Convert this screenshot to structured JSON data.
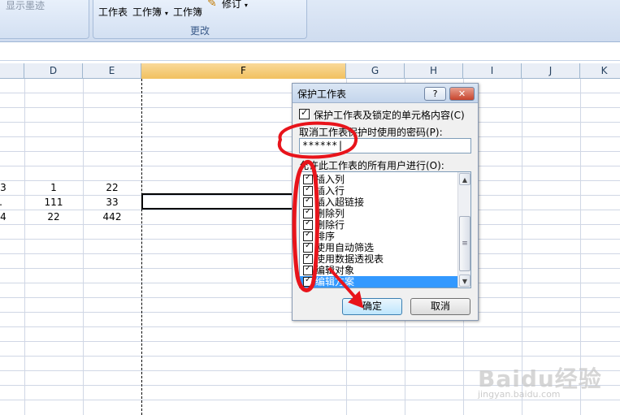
{
  "ribbon": {
    "ghost_text_left": "显示墨迹",
    "worksheet_btn": "工作表",
    "workbook_btn": "工作簿",
    "workbook_btn2": "工作簿",
    "revise_btn": "修订",
    "changes_group": "更改"
  },
  "columns": [
    "D",
    "E",
    "F",
    "G",
    "H",
    "I",
    "J",
    "K"
  ],
  "selected_column": "F",
  "cells": {
    "r1": [
      "3",
      "1",
      "22"
    ],
    "r2": [
      ".",
      "111",
      "33"
    ],
    "r3": [
      "4",
      "22",
      "442"
    ]
  },
  "dialog": {
    "title": "保护工作表",
    "help": "?",
    "close": "✕",
    "protect_label": "保护工作表及锁定的单元格内容(C)",
    "password_label": "取消工作表保护时使用的密码(P):",
    "password_value": "******|",
    "allow_label": "允许此工作表的所有用户进行(O):",
    "permissions": [
      "插入列",
      "插入行",
      "插入超链接",
      "删除列",
      "删除行",
      "排序",
      "使用自动筛选",
      "使用数据透视表",
      "编辑对象",
      "编辑方案"
    ],
    "selected_permission": "编辑方案",
    "ok": "确定",
    "cancel": "取消"
  },
  "annotation_color": "#e8141b",
  "watermark": {
    "main": "Baidu经验",
    "sub": "jingyan.baidu.com"
  }
}
